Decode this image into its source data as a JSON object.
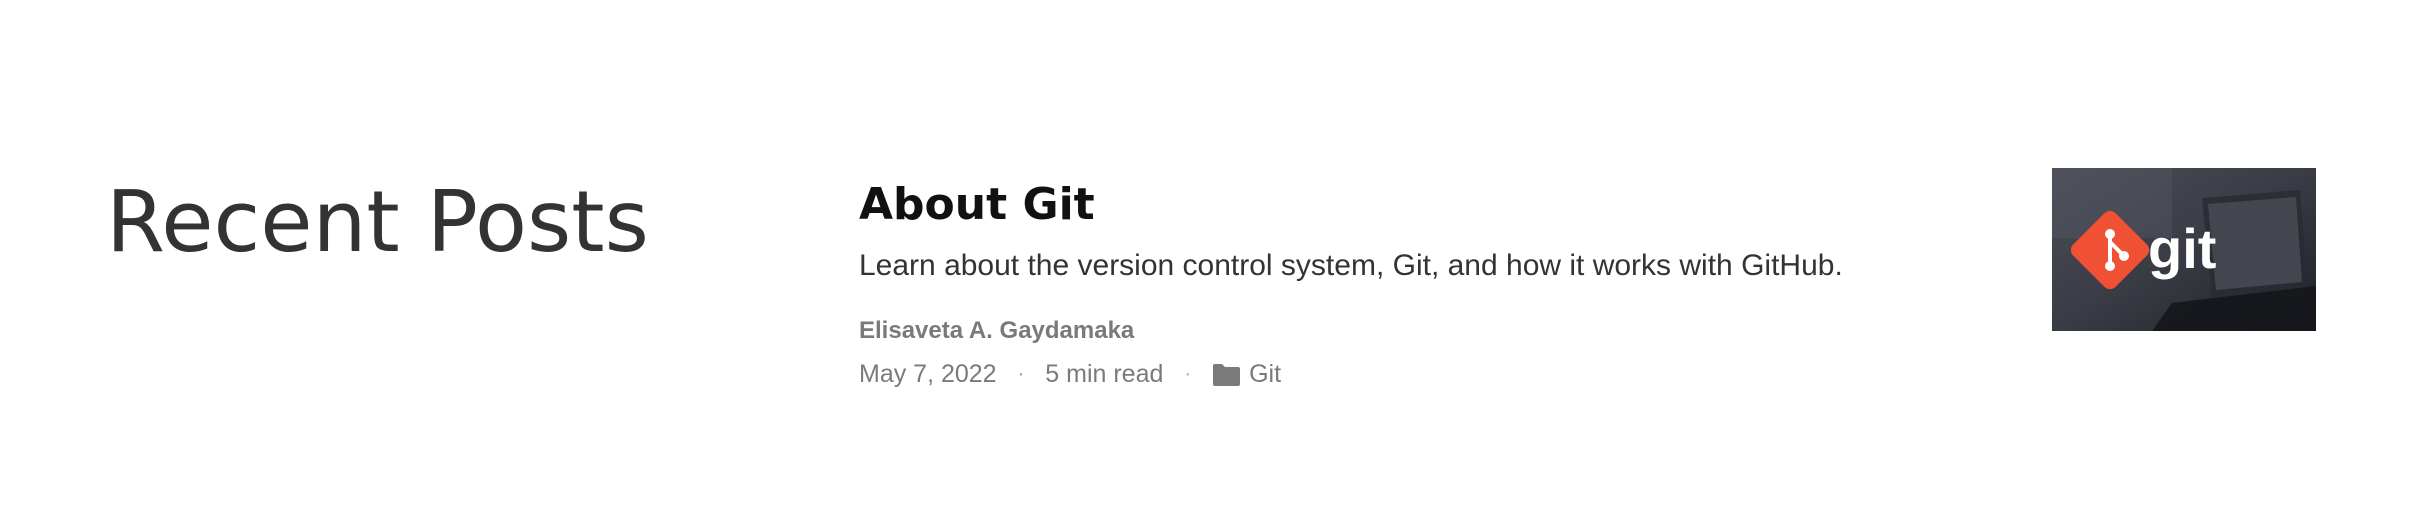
{
  "section": {
    "title": "Recent Posts"
  },
  "post": {
    "title": "About Git",
    "excerpt": "Learn about the version control system, Git, and how it works with GitHub.",
    "author": "Elisaveta A. Gaydamaka",
    "date": "May 7, 2022",
    "read_time": "5 min read",
    "category": "Git",
    "separator": "·",
    "thumbnail": {
      "logo_text": "git",
      "icon": "git-logo-icon"
    }
  },
  "colors": {
    "git_brand": "#f05033",
    "meta_text": "#7a7a7a",
    "title_text": "#111111"
  }
}
